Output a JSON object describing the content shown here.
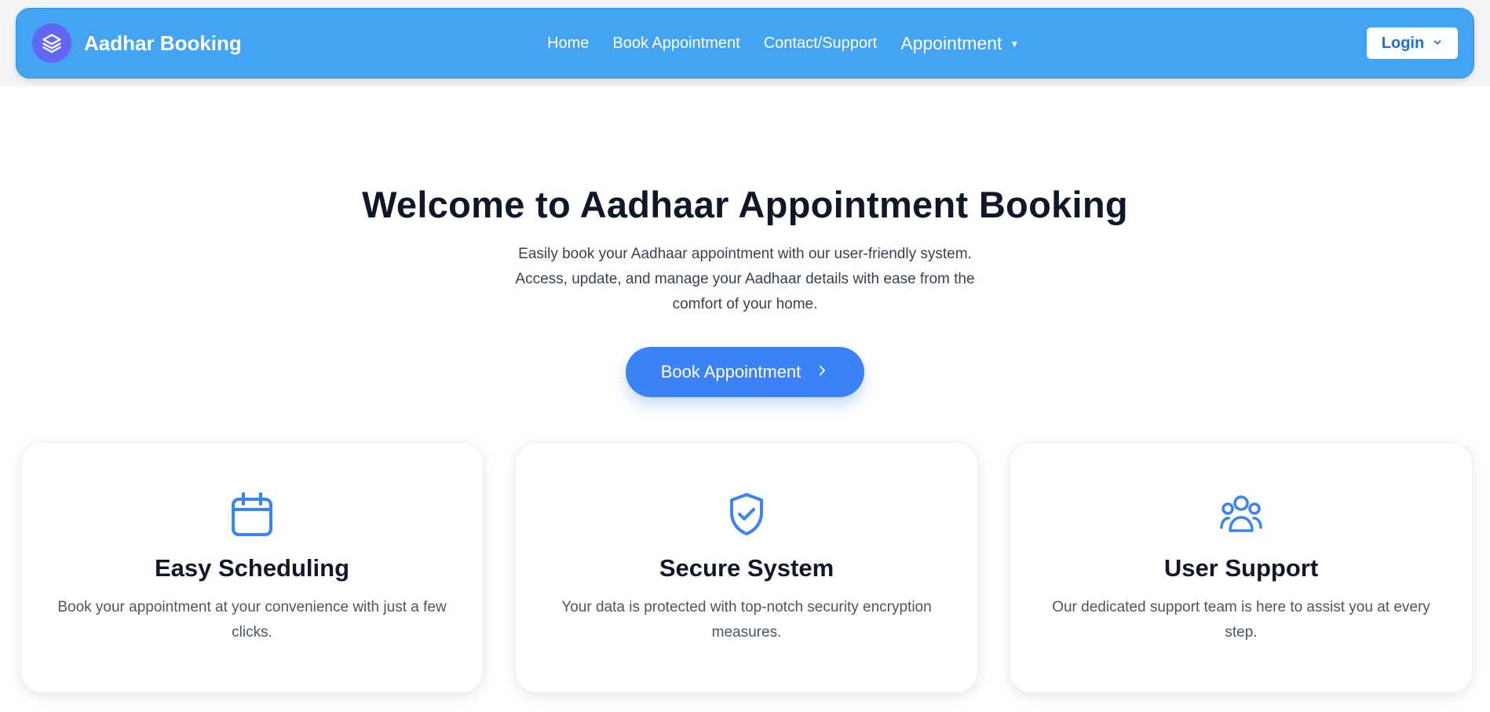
{
  "brand": {
    "name": "Aadhar Booking",
    "logo_icon": "layers-icon"
  },
  "nav": {
    "links": [
      "Home",
      "Book Appointment",
      "Contact/Support"
    ],
    "dropdown_label": "Appointment"
  },
  "login": {
    "label": "Login"
  },
  "hero": {
    "title": "Welcome to Aadhaar Appointment Booking",
    "subtitle": "Easily book your Aadhaar appointment with our user-friendly system. Access, update, and manage your Aadhaar details with ease from the comfort of your home.",
    "cta_label": "Book Appointment"
  },
  "features": [
    {
      "icon": "calendar-icon",
      "title": "Easy Scheduling",
      "description": "Book your appointment at your convenience with just a few clicks."
    },
    {
      "icon": "shield-check-icon",
      "title": "Secure System",
      "description": "Your data is protected with top-notch security encryption measures."
    },
    {
      "icon": "users-icon",
      "title": "User Support",
      "description": "Our dedicated support team is here to assist you at every step."
    }
  ],
  "colors": {
    "navbar": "#44a4f4",
    "accent": "#3b82f6",
    "logo_bg": "#6366f1"
  }
}
